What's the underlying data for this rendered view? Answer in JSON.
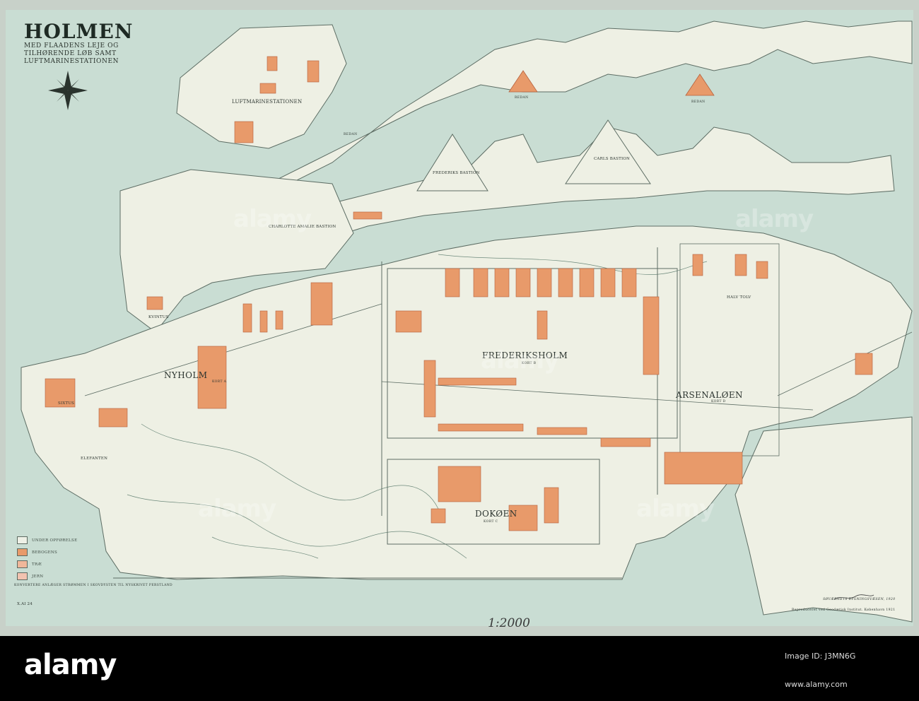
{
  "map": {
    "title": "HOLMEN",
    "subtitle_lines": [
      "MED FLAADENS LEJE OG",
      "TILHØRENDE LØB SAMT",
      "LUFTMARINESTATIONEN"
    ],
    "district_labels": {
      "luftmarinestationen": "LUFTMARINESTATIONEN",
      "nyholm": "NYHOLM",
      "frederiksholm": "FREDERIKSHOLM",
      "arsenaloen": "ARSENALØEN",
      "dokoen": "DOKØEN",
      "halv_tolv": "HALV TOLV",
      "frederiks_bastion": "FREDERIKS BASTION",
      "carls_bastion": "CARLS BASTION",
      "charlotte_amalie_bastion": "CHARLOTTE AMALIE BASTION",
      "sixtus": "SIXTUS",
      "kvintus": "KVINTUS",
      "elefanten": "ELEFANTEN",
      "redan_1": "REDAN",
      "redan_2": "REDAN",
      "redan_3": "REDAN",
      "kort_a": "KORT A",
      "kort_b": "KORT B",
      "kort_c": "KORT C",
      "kort_d": "KORT D"
    },
    "legend": [
      {
        "label": "UNDER OPFØRELSE",
        "color": "#eef0e6"
      },
      {
        "label": "BEBOGENS",
        "color": "#e89a6a"
      },
      {
        "label": "TRÆ",
        "color": "#f0b79a"
      },
      {
        "label": "JERN",
        "color": "#f2c3b0"
      }
    ],
    "notes_bottom_left": "KONVERTERE ANLÆGER STRØMMEN I SKOVDYSTEN TIL NYSKRIVET PERSTLAND",
    "sheet_id": "X.AI 24",
    "scale_handwritten": "1:2000",
    "imprint_line_1": "SØVÆRNETS BYGNINGSVÆSEN, 1920",
    "imprint_line_2": "Reproduceret ved Geodætisk Institut. København 1921",
    "colors": {
      "water": "#c9ddd3",
      "land": "#eef0e4",
      "building": "#e89a6a",
      "building_stroke": "#b5603c",
      "line": "#5d6d64"
    }
  },
  "watermark": {
    "brand": "alamy",
    "image_id_label": "Image ID: J3MN6G",
    "image_id": "J3MN6G",
    "url": "www.alamy.com"
  }
}
